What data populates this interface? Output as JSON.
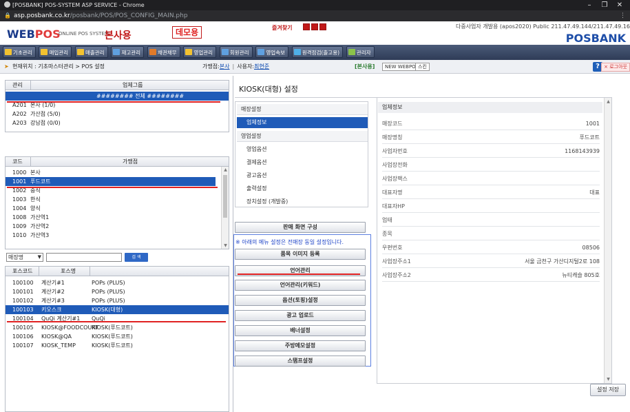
{
  "browser": {
    "title": "[POSBANK] POS-SYSTEM ASP SERVICE - Chrome",
    "url_host": "asp.posbank.co.kr",
    "url_path": "/posbank/POS/POS_CONFIG_MAIN.php"
  },
  "header": {
    "logo_web": "WEB",
    "logo_pos": "POS",
    "online_text": "ONLINE POS SYSTEM",
    "bonsa": "본사용",
    "demo": "데모용",
    "favorites": "즐겨찾기",
    "info_line": "다중사업자 개발용 (apos2020) Public 211.47.49.144/211.47.49.16",
    "brand": "POSBANK"
  },
  "menu": [
    {
      "label": "기초관리",
      "color": "#f2c230"
    },
    {
      "label": "매입관리",
      "color": "#f2c230"
    },
    {
      "label": "매출관리",
      "color": "#f2c230"
    },
    {
      "label": "재고관리",
      "color": "#5fa0e0"
    },
    {
      "label": "채권채무",
      "color": "#e07a2a"
    },
    {
      "label": "영업관리",
      "color": "#f2c230"
    },
    {
      "label": "회원관리",
      "color": "#5fa0e0"
    },
    {
      "label": "영업속보",
      "color": "#5fa0e0"
    },
    {
      "label": "원격점검(출고용)",
      "color": "#4fb0e8"
    },
    {
      "label": "관리자",
      "color": "#8bc34a"
    }
  ],
  "locbar": {
    "location": "현재위치 : 기초마스터관리 > POS 설정",
    "store_label": "가맹점:",
    "store_value": "본사",
    "user_label": "사용자:",
    "user_value": "최현준",
    "tag": "[본사용]",
    "new_webpos": "NEW WEBPOS",
    "skin": "스킨",
    "help": "?",
    "logout": "× 로그아웃"
  },
  "group_grid": {
    "headers": [
      "관리",
      "업체그룹"
    ],
    "all_row": "######## 전체 ########",
    "rows": [
      {
        "code": "A201",
        "name": "본사 (1/0)"
      },
      {
        "code": "A202",
        "name": "가산점 (5/0)"
      },
      {
        "code": "A203",
        "name": "강남점 (0/0)"
      }
    ]
  },
  "store_grid": {
    "headers": [
      "코드",
      "가맹점"
    ],
    "rows": [
      {
        "code": "1000",
        "name": "본사"
      },
      {
        "code": "1001",
        "name": "푸드코트",
        "selected": true
      },
      {
        "code": "1002",
        "name": "중식"
      },
      {
        "code": "1003",
        "name": "한식"
      },
      {
        "code": "1004",
        "name": "양식"
      },
      {
        "code": "1008",
        "name": "가산역1"
      },
      {
        "code": "1009",
        "name": "가산역2"
      },
      {
        "code": "1010",
        "name": "가산역3"
      }
    ]
  },
  "filter": {
    "select_value": "매장명",
    "search_button": "검 색"
  },
  "pos_grid": {
    "headers": [
      "포스코드",
      "포스명"
    ],
    "rows": [
      {
        "code": "100100",
        "name": "계산기#1",
        "type": "POPs (PLUS)"
      },
      {
        "code": "100101",
        "name": "계산기#2",
        "type": "POPs (PLUS)"
      },
      {
        "code": "100102",
        "name": "계산기#3",
        "type": "POPs (PLUS)"
      },
      {
        "code": "100103",
        "name": "키오스크",
        "type": "KIOSK(대형)",
        "selected": true
      },
      {
        "code": "100104",
        "name": "QuQi 계산기#1",
        "type": "QuQi"
      },
      {
        "code": "100105",
        "name": "KIOSK@FOODCOURT",
        "type": "KIOSK(푸드코트)"
      },
      {
        "code": "100106",
        "name": "KIOSK@QA",
        "type": "KIOSK(푸드코트)"
      },
      {
        "code": "100107",
        "name": "KIOSK_TEMP",
        "type": "KIOSK(푸드코트)"
      }
    ]
  },
  "page": {
    "title": "KIOSK(대형) 설정"
  },
  "side_menu": {
    "h1": "매장설정",
    "i1": "업체정보",
    "h2": "영업설정",
    "i2": "영업옵션",
    "i3": "결제옵션",
    "i4": "광고옵션",
    "i5": "출력설정",
    "i6": "장치설정 (개발중)"
  },
  "buttons": {
    "sales_screen": "판매 화면 구성",
    "notice": "※ 아래의 메뉴 설정은 전매장 동일 설정입니다.",
    "item_image": "품목 이미지 등록",
    "language": "언어관리",
    "language_keyword": "언어관리(키워드)",
    "options": "옵션(토핑)설정",
    "ad_upload": "광고 업로드",
    "banner": "배너설정",
    "kitchen_memo": "주방메모설정",
    "stamp": "스탬프설정",
    "save": "설정 저장"
  },
  "info": {
    "header": "업체정보",
    "rows": [
      {
        "label": "매장코드",
        "value": "1001"
      },
      {
        "label": "매장명칭",
        "value": "푸드코트"
      },
      {
        "label": "사업자번호",
        "value": "1168143939"
      },
      {
        "label": "사업장전화",
        "value": ""
      },
      {
        "label": "사업장팩스",
        "value": ""
      },
      {
        "label": "대표자명",
        "value": "대표"
      },
      {
        "label": "대표자HP",
        "value": ""
      },
      {
        "label": "업태",
        "value": ""
      },
      {
        "label": "종목",
        "value": ""
      },
      {
        "label": "우편번호",
        "value": "08506"
      },
      {
        "label": "사업장주소1",
        "value": "서울 금천구 가산디지털2로 108"
      },
      {
        "label": "사업장주소2",
        "value": "뉴티캐슬 805호"
      }
    ]
  }
}
